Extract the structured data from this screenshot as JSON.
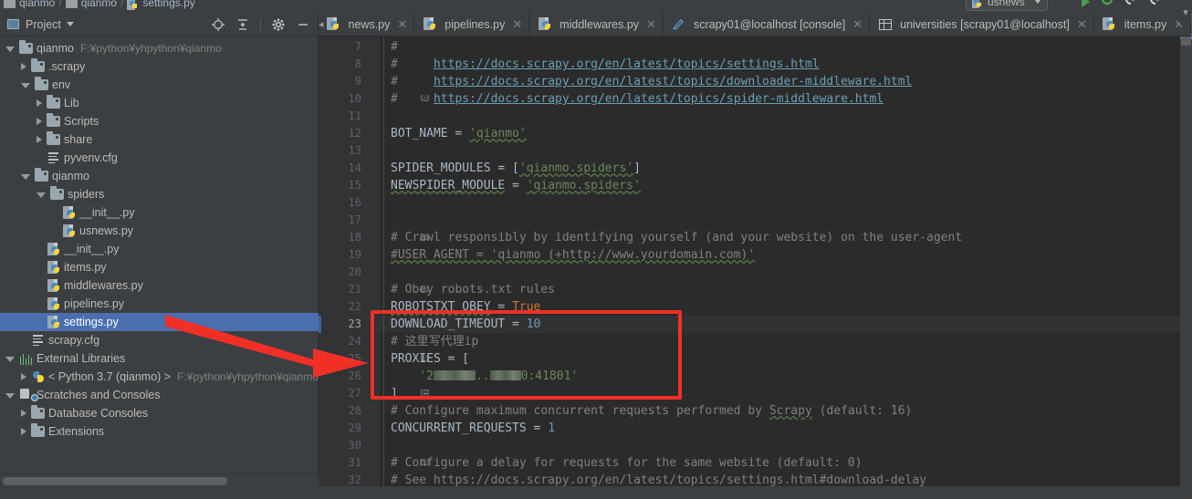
{
  "breadcrumb": {
    "parts": [
      "qianmo",
      "qianmo",
      "settings.py"
    ],
    "separator": "/"
  },
  "run_config": {
    "name": "usnews",
    "icons": [
      "run-icon",
      "build-icon",
      "debug-icon",
      "coverage-icon",
      "profile-icon",
      "stop-icon"
    ]
  },
  "project_panel": {
    "title": "Project",
    "tools": [
      "locate-icon",
      "collapse-all-icon",
      "settings-gear-icon",
      "hide-icon"
    ],
    "tree": [
      {
        "label": "qianmo",
        "path": "F:¥python¥yhpython¥qianmo",
        "icon": "folder-icon",
        "indent": 0,
        "state": "open"
      },
      {
        "label": ".scrapy",
        "icon": "folder-icon",
        "indent": 1,
        "state": "closed"
      },
      {
        "label": "env",
        "icon": "folder-icon",
        "indent": 1,
        "state": "open"
      },
      {
        "label": "Lib",
        "icon": "folder-icon",
        "indent": 2,
        "state": "closed"
      },
      {
        "label": "Scripts",
        "icon": "folder-icon",
        "indent": 2,
        "state": "closed"
      },
      {
        "label": "share",
        "icon": "folder-icon",
        "indent": 2,
        "state": "closed"
      },
      {
        "label": "pyvenv.cfg",
        "icon": "config-file-icon",
        "indent": 2,
        "state": "leaf"
      },
      {
        "label": "qianmo",
        "icon": "folder-icon",
        "indent": 1,
        "state": "open"
      },
      {
        "label": "spiders",
        "icon": "folder-icon",
        "indent": 2,
        "state": "open"
      },
      {
        "label": "__init__.py",
        "icon": "python-file-icon",
        "indent": 3,
        "state": "leaf"
      },
      {
        "label": "usnews.py",
        "icon": "python-file-icon",
        "indent": 3,
        "state": "leaf"
      },
      {
        "label": "__init__.py",
        "icon": "python-file-icon",
        "indent": 2,
        "state": "leaf"
      },
      {
        "label": "items.py",
        "icon": "python-file-icon",
        "indent": 2,
        "state": "leaf"
      },
      {
        "label": "middlewares.py",
        "icon": "python-file-icon",
        "indent": 2,
        "state": "leaf"
      },
      {
        "label": "pipelines.py",
        "icon": "python-file-icon",
        "indent": 2,
        "state": "leaf"
      },
      {
        "label": "settings.py",
        "icon": "python-file-icon",
        "indent": 2,
        "state": "leaf",
        "selected": true
      },
      {
        "label": "scrapy.cfg",
        "icon": "config-file-icon",
        "indent": 1,
        "state": "leaf"
      },
      {
        "label": "External Libraries",
        "icon": "external-libraries-icon",
        "indent": 0,
        "state": "open"
      },
      {
        "label": "< Python 3.7 (qianmo) >",
        "path": "F:¥python¥yhpython¥qianmo",
        "icon": "python-interpreter-icon",
        "indent": 1,
        "state": "closed"
      },
      {
        "label": "Scratches and Consoles",
        "icon": "scratches-icon",
        "indent": 0,
        "state": "open"
      },
      {
        "label": "Database Consoles",
        "icon": "folder-icon",
        "indent": 1,
        "state": "closed"
      },
      {
        "label": "Extensions",
        "icon": "folder-icon",
        "indent": 1,
        "state": "closed"
      }
    ]
  },
  "tabs": [
    {
      "label": "news.py",
      "icon": "python-file-icon",
      "active": false,
      "clipped": true
    },
    {
      "label": "pipelines.py",
      "icon": "python-file-icon",
      "active": false
    },
    {
      "label": "middlewares.py",
      "icon": "python-file-icon",
      "active": false
    },
    {
      "label": "scrapy01@localhost [console]",
      "icon": "console-icon",
      "active": false
    },
    {
      "label": "universities [scrapy01@localhost]",
      "icon": "table-icon",
      "active": false
    },
    {
      "label": "items.py",
      "icon": "python-file-icon",
      "active": false
    },
    {
      "label": "settings.py",
      "icon": "python-file-icon",
      "active": true
    }
  ],
  "editor": {
    "close_glyph": "✕",
    "first_line": 7,
    "current_line": 23,
    "lines": [
      {
        "n": 7,
        "tokens": [
          {
            "t": "#",
            "c": "c-com"
          }
        ]
      },
      {
        "n": 8,
        "tokens": [
          {
            "t": "#     ",
            "c": "c-com"
          },
          {
            "t": "https://docs.scrapy.org/en/latest/topics/settings.html",
            "c": "c-link"
          }
        ]
      },
      {
        "n": 9,
        "tokens": [
          {
            "t": "#     ",
            "c": "c-com"
          },
          {
            "t": "https://docs.scrapy.org/en/latest/topics/downloader-middleware.html",
            "c": "c-link"
          }
        ]
      },
      {
        "n": 10,
        "tokens": [
          {
            "t": "#     ",
            "c": "c-com"
          },
          {
            "t": "https://docs.scrapy.org/en/latest/topics/spider-middleware.html",
            "c": "c-link"
          }
        ],
        "fold": "tip"
      },
      {
        "n": 11,
        "tokens": []
      },
      {
        "n": 12,
        "tokens": [
          {
            "t": "BOT_NAME",
            "c": "c-id"
          },
          {
            "t": " = ",
            "c": "c-id"
          },
          {
            "t": "'qianmo'",
            "c": "c-str wavy"
          }
        ]
      },
      {
        "n": 13,
        "tokens": []
      },
      {
        "n": 14,
        "tokens": [
          {
            "t": "SPIDER_MODULES",
            "c": "c-id"
          },
          {
            "t": " = [",
            "c": "c-id"
          },
          {
            "t": "'qianmo.spiders'",
            "c": "c-str wavy"
          },
          {
            "t": "]",
            "c": "c-id"
          }
        ]
      },
      {
        "n": 15,
        "tokens": [
          {
            "t": "NEWSPIDER_MODULE",
            "c": "c-id wavy"
          },
          {
            "t": " = ",
            "c": "c-id"
          },
          {
            "t": "'qianmo.spiders'",
            "c": "c-str wavy"
          }
        ]
      },
      {
        "n": 16,
        "tokens": []
      },
      {
        "n": 17,
        "tokens": []
      },
      {
        "n": 18,
        "tokens": [
          {
            "t": "# Crawl responsibly by identifying yourself (and your website) on the user-agent",
            "c": "c-com"
          }
        ],
        "fold": "tip"
      },
      {
        "n": 19,
        "tokens": [
          {
            "t": "#USER_AGENT = 'qianmo (+http://www.yourdomain.com)'",
            "c": "c-com wavy"
          }
        ]
      },
      {
        "n": 20,
        "tokens": []
      },
      {
        "n": 21,
        "tokens": [
          {
            "t": "# Obey robots.txt rules",
            "c": "c-com"
          }
        ],
        "fold": "tip"
      },
      {
        "n": 22,
        "tokens": [
          {
            "t": "ROBOTSTXT_OBEY",
            "c": "c-id wavy"
          },
          {
            "t": " = ",
            "c": "c-id"
          },
          {
            "t": "True",
            "c": "c-key"
          }
        ]
      },
      {
        "n": 23,
        "tokens": [
          {
            "t": "DOWNLOAD_TIMEOUT",
            "c": "c-id"
          },
          {
            "t": " = ",
            "c": "c-id"
          },
          {
            "t": "10",
            "c": "c-num"
          }
        ]
      },
      {
        "n": 24,
        "tokens": [
          {
            "t": "# 这里写代理ip",
            "c": "c-com"
          }
        ]
      },
      {
        "n": 25,
        "tokens": [
          {
            "t": "PROXIES",
            "c": "c-id"
          },
          {
            "t": " = [",
            "c": "c-id"
          }
        ],
        "fold": "tip"
      },
      {
        "n": 26,
        "tokens": [
          {
            "t": "    '2",
            "c": "c-str"
          },
          {
            "t": "__BLUR1__",
            "c": "blur"
          },
          {
            "t": "..",
            "c": "c-str"
          },
          {
            "t": "__BLUR2__",
            "c": "blur"
          },
          {
            "t": "0:41801'",
            "c": "c-str"
          }
        ]
      },
      {
        "n": 27,
        "tokens": [
          {
            "t": "]",
            "c": "c-id"
          }
        ],
        "fold": "box"
      },
      {
        "n": 28,
        "tokens": [
          {
            "t": "# Configure maximum concurrent requests performed by ",
            "c": "c-com"
          },
          {
            "t": "Scrapy",
            "c": "c-com wavy"
          },
          {
            "t": " (default: 16)",
            "c": "c-com"
          }
        ]
      },
      {
        "n": 29,
        "tokens": [
          {
            "t": "CONCURRENT_REQUESTS",
            "c": "c-id"
          },
          {
            "t": " = ",
            "c": "c-id"
          },
          {
            "t": "1",
            "c": "c-num"
          }
        ]
      },
      {
        "n": 30,
        "tokens": []
      },
      {
        "n": 31,
        "tokens": [
          {
            "t": "# Configure a delay for requests for the same website (default: 0)",
            "c": "c-com"
          }
        ],
        "fold": "tip"
      },
      {
        "n": 32,
        "tokens": [
          {
            "t": "# See https://docs.scrapy.org/en/latest/topics/settings.html#download-delay",
            "c": "c-com"
          }
        ]
      }
    ]
  },
  "annotations": {
    "box_color": "#f03027",
    "arrow_color": "#f03027",
    "box_note": "highlight-proxies-block",
    "arrow_note": "points-from-settings-py-to-proxies"
  }
}
